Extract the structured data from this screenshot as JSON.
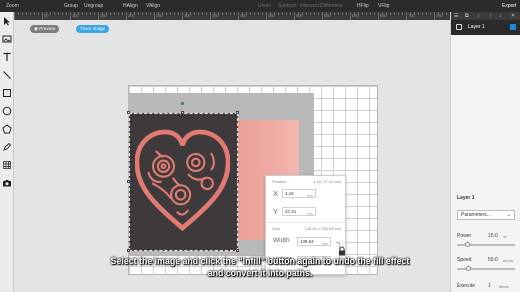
{
  "toolbar": {
    "zoom": "Zoom",
    "group": "Group",
    "ungroup": "Ungroup",
    "halign": "HAlign",
    "valign": "VAlign",
    "greyed": [
      "Union",
      "Subtract",
      "Intersect",
      "Difference"
    ],
    "hflip": "HFlip",
    "vflip": "VFlip",
    "export": "Export"
  },
  "ruler": {
    "labels": [
      "50",
      "100",
      "150",
      "200",
      "250",
      "300",
      "350",
      "400",
      "450",
      "500",
      "550",
      "600",
      "650",
      "700",
      "750"
    ]
  },
  "tools": [
    "pointer-icon",
    "image-icon",
    "text-icon",
    "line-icon",
    "rectangle-icon",
    "circle-icon",
    "pentagon-icon",
    "pen-icon",
    "grid-icon",
    "camera-icon"
  ],
  "canvas": {
    "preview_label": "Preview",
    "trace_label": "Trace Image"
  },
  "popup": {
    "position_label": "Position",
    "position_readout": "4.16, 37.41 mm",
    "x_label": "X",
    "x_value": "4.16",
    "y_label": "Y",
    "y_value": "37.41",
    "unit": "mm",
    "size_label": "Size",
    "size_readout": "138.64 x 138.64 mm",
    "width_label": "Width",
    "width_value": "138.64",
    "height_label": "Height",
    "height_value": "138.64"
  },
  "caption": {
    "line1": "Select the image and click the “Infill” button again to undo the fill effect",
    "line2": "and convert it into paths."
  },
  "layers": {
    "layer_name": "Layer 1"
  },
  "properties": {
    "title": "Layer 1",
    "dropdown": "Parameters...",
    "power_label": "Power",
    "power_value": "15.0",
    "power_unit": "%",
    "power_level": 0.15,
    "speed_label": "Speed",
    "speed_value": "50.0",
    "speed_unit": "mm/s",
    "speed_level": 0.17,
    "execute_label": "Execute",
    "execute_value": "1",
    "execute_unit": "times"
  },
  "colors": {
    "heart": "#e07a72",
    "accent": "#3aa6e6",
    "toolbar": "#2b2b2b"
  }
}
